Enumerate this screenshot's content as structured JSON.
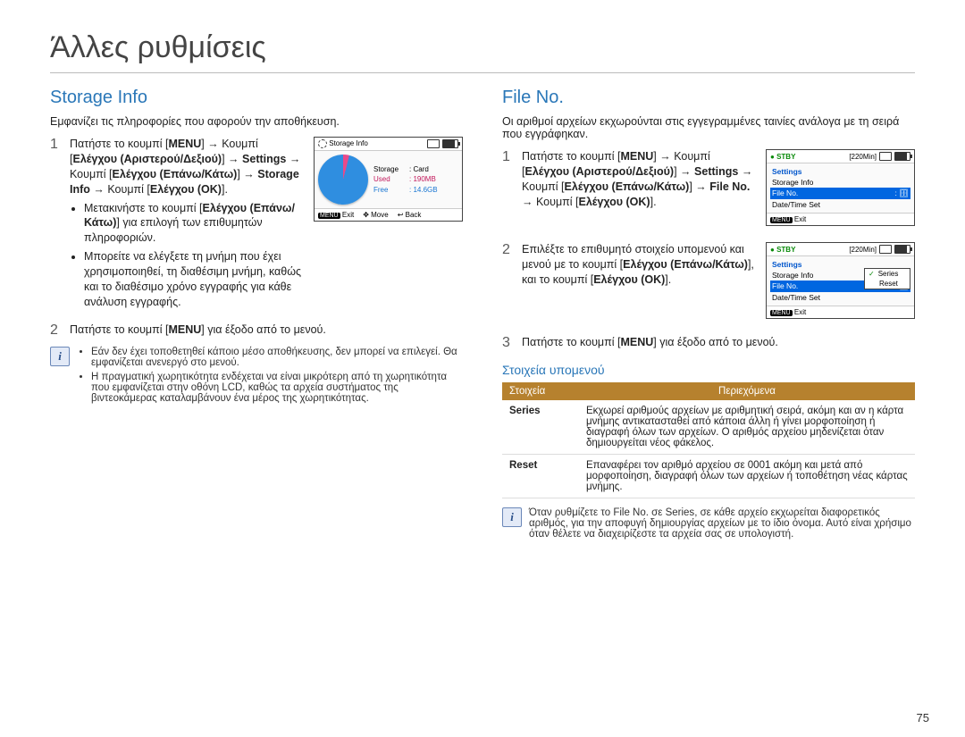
{
  "chapterTitle": "Άλλες ρυθμίσεις",
  "pageNumber": "75",
  "left": {
    "title": "Storage Info",
    "intro": "Εμφανίζει τις πληροφορίες που αφορούν την αποθήκευση.",
    "step1_line1_a": "Πατήστε το κουμπί [",
    "step1_line1_b": "MENU",
    "step1_line1_c": "] → Κουμπί [",
    "step1_line1_d": "Ελέγχου (Αριστερού/Δεξιού)",
    "step1_line1_e": "] → ",
    "step1_line1_f": "Settings",
    "step1_line1_g": " → Κουμπί [",
    "step1_line1_h": "Ελέγχου (Επάνω/Κάτω)",
    "step1_line1_i": "] → ",
    "step1_line1_j": "Storage Info",
    "step1_line1_k": " → Κουμπί [",
    "step1_line1_l": "Ελέγχου (OK)",
    "step1_line1_m": "].",
    "step1_sub1_a": "Μετακινήστε το κουμπί [",
    "step1_sub1_b": "Ελέγχου (Επάνω/Κάτω)",
    "step1_sub1_c": "] για επιλογή των επιθυμητών πληροφοριών.",
    "step1_sub2": "Μπορείτε να ελέγξετε τη μνήμη που έχει χρησιμοποιηθεί, τη διαθέσιμη μνήμη, καθώς και το διαθέσιμο χρόνο εγγραφής για κάθε ανάλυση εγγραφής.",
    "step2_a": "Πατήστε το κουμπί [",
    "step2_b": "MENU",
    "step2_c": "] για έξοδο από το μενού.",
    "note1": "Εάν δεν έχει τοποθετηθεί κάποιο μέσο αποθήκευσης, δεν μπορεί να επιλεγεί. Θα εμφανίζεται ανενεργό στο μενού.",
    "note2": "Η πραγματική χωρητικότητα ενδέχεται να είναι μικρότερη από τη χωρητικότητα που εμφανίζεται στην οθόνη LCD, καθώς τα αρχεία συστήματος της βιντεοκάμερας καταλαμβάνουν ένα μέρος της χωρητικότητας.",
    "lcd": {
      "header": "Storage Info",
      "storage_l": "Storage",
      "storage_v": ": Card",
      "used_l": "Used",
      "used_v": ": 190MB",
      "free_l": "Free",
      "free_v": ": 14.6GB",
      "exit": "Exit",
      "move": "Move",
      "back": "Back",
      "menu": "MENU"
    }
  },
  "right": {
    "title": "File No.",
    "intro": "Οι αριθμοί αρχείων εκχωρούνται στις εγγεγραμμένες ταινίες ανάλογα με τη σειρά που εγγράφηκαν.",
    "step1_a": "Πατήστε το κουμπί [",
    "step1_b": "MENU",
    "step1_c": "] → Κουμπί [",
    "step1_d": "Ελέγχου (Αριστερού/Δεξιού)",
    "step1_e": "] → ",
    "step1_f": "Settings",
    "step1_g": " → Κουμπί [",
    "step1_h": "Ελέγχου (Επάνω/Κάτω)",
    "step1_i": "] → ",
    "step1_j": "File No.",
    "step1_k": " → Κουμπί [",
    "step1_l": "Ελέγχου (OK)",
    "step1_m": "].",
    "step2_a": "Επιλέξτε το επιθυμητό στοιχείο υπομενού και μενού με το κουμπί [",
    "step2_b": "Ελέγχου (Επάνω/Κάτω)",
    "step2_c": "], και το κουμπί [",
    "step2_d": "Ελέγχου (OK)",
    "step2_e": "].",
    "step3_a": "Πατήστε το κουμπί [",
    "step3_b": "MENU",
    "step3_c": "] για έξοδο από το μενού.",
    "submenuTitle": "Στοιχεία υπομενού",
    "th1": "Στοιχεία",
    "th2": "Περιεχόμενα",
    "row1_k": "Series",
    "row1_v": "Εκχωρεί αριθμούς αρχείων με αριθμητική σειρά, ακόμη και αν η κάρτα μνήμης αντικατασταθεί από κάποια άλλη ή γίνει μορφοποίηση ή διαγραφή όλων των αρχείων. Ο αριθμός αρχείου μηδενίζεται όταν δημιουργείται νέος φάκελος.",
    "row2_k": "Reset",
    "row2_v": "Επαναφέρει τον αριθμό αρχείου σε 0001 ακόμη και μετά από μορφοποίηση, διαγραφή όλων των αρχείων ή τοποθέτηση νέας κάρτας μνήμης.",
    "note_a": "Όταν ρυθμίζετε το ",
    "note_b": "File No.",
    "note_c": " σε ",
    "note_d": "Series",
    "note_e": ", σε κάθε αρχείο εκχωρείται διαφορετικός αριθμός, για την αποφυγή δημιουργίας αρχείων με το ίδιο όνομα. Αυτό είναι χρήσιμο όταν θέλετε να διαχειρίζεστε τα αρχεία σας σε υπολογιστή.",
    "lcd1": {
      "stby": "STBY",
      "time": "[220Min]",
      "settings": "Settings",
      "storage": "Storage Info",
      "fileno": "File No.",
      "datetime": "Date/Time Set",
      "exit": "Exit",
      "menu": "MENU"
    },
    "lcd2": {
      "stby": "STBY",
      "time": "[220Min]",
      "settings": "Settings",
      "storage": "Storage Info",
      "fileno": "File No.",
      "datetime": "Date/Time Set",
      "pop_series": "Series",
      "pop_reset": "Reset",
      "exit": "Exit",
      "menu": "MENU"
    }
  }
}
